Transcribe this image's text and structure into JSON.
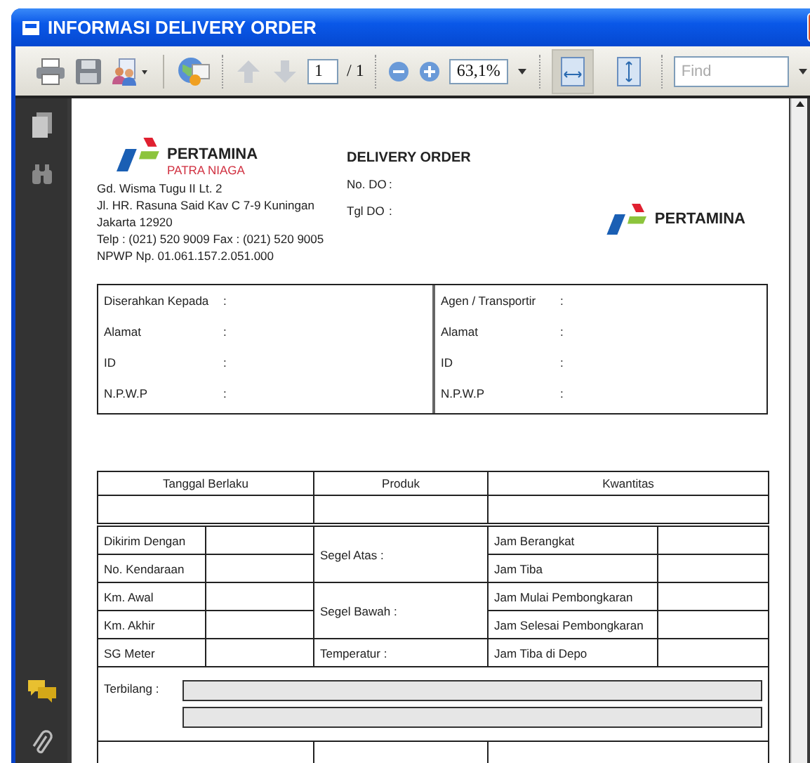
{
  "window": {
    "title": "INFORMASI DELIVERY ORDER"
  },
  "toolbar": {
    "page": "1",
    "page_total": "/ 1",
    "zoom": "63,1%",
    "find": {
      "placeholder": "Find"
    },
    "view_buttons": [
      {
        "kind": "fit-width",
        "selected": true
      },
      {
        "kind": "fit-page",
        "selected": false
      }
    ]
  },
  "document": {
    "company_logo": {
      "name": "PERTAMINA",
      "subtitle": "PATRA NIAGA"
    },
    "address_lines": [
      "Gd. Wisma Tugu II Lt. 2",
      "Jl. HR. Rasuna Said Kav C 7-9 Kuningan",
      "Jakarta 12920",
      "Telp : (021) 520 9009 Fax : (021) 520 9005",
      "NPWP Np. 01.061.157.2.051.000"
    ],
    "title": "DELIVERY ORDER",
    "header_fields": [
      {
        "label": "No. DO",
        "separator": ":"
      },
      {
        "label": "Tgl DO",
        "separator": ":"
      }
    ],
    "right_logo": {
      "name": "PERTAMINA"
    },
    "parties": [
      {
        "fields": [
          {
            "label": "Diserahkan Kepada",
            "separator": ":"
          },
          {
            "label": "Alamat",
            "separator": ":"
          },
          {
            "label": "ID",
            "separator": ":"
          },
          {
            "label": "N.P.W.P",
            "separator": ":"
          }
        ]
      },
      {
        "fields": [
          {
            "label": "Agen / Transportir",
            "separator": ":"
          },
          {
            "label": "Alamat",
            "separator": ":"
          },
          {
            "label": "ID",
            "separator": ":"
          },
          {
            "label": "N.P.W.P",
            "separator": ":"
          }
        ]
      }
    ],
    "table": {
      "columns": [
        "Tanggal Berlaku",
        "Produk",
        "Kwantitas"
      ],
      "left_labels": [
        "Dikirim Dengan",
        "No. Kendaraan",
        "Km. Awal",
        "Km. Akhir",
        "SG Meter"
      ],
      "middle_labels": [
        {
          "label": "Segel Atas :",
          "kind": "double"
        },
        {
          "label": "Segel Bawah :",
          "kind": "double"
        },
        {
          "label": "Temperatur :",
          "kind": "single"
        }
      ],
      "right_labels": [
        "Jam Berangkat",
        "Jam Tiba",
        "Jam Mulai Pembongkaran",
        "Jam Selesai Pembongkaran",
        "Jam Tiba di Depo"
      ],
      "terbilang": {
        "label": "Terbilang :"
      }
    }
  }
}
